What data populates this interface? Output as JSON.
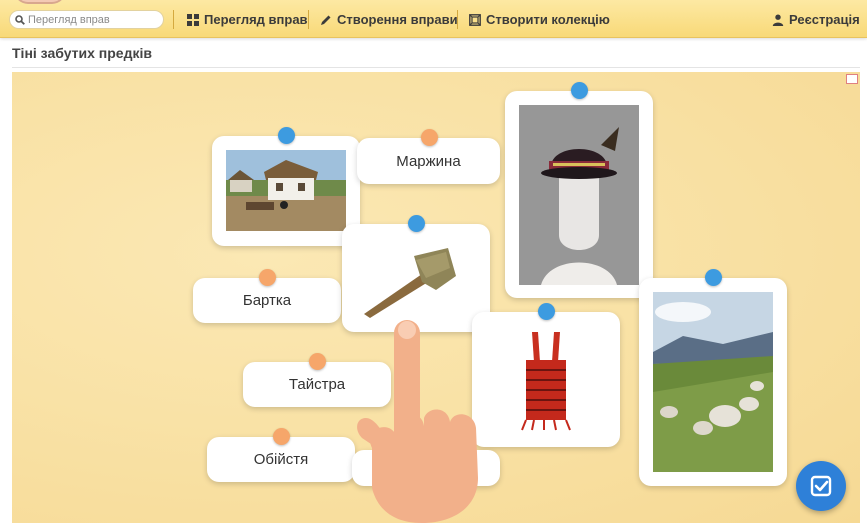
{
  "header": {
    "search_placeholder": "Перегляд вправ",
    "nav": {
      "browse": "Перегляд вправ",
      "create": "Створення вправи",
      "collection": "Створити колекцію",
      "register": "Реєстрація"
    }
  },
  "page": {
    "title": "Тіні забутих предків"
  },
  "words": {
    "marzhyna": "Маржина",
    "bartka": "Бартка",
    "taistra": "Тайстра",
    "obiistia": "Обійстя"
  },
  "icons": {
    "search": "search-icon",
    "grid": "grid-icon",
    "pencil": "pencil-icon",
    "collection": "collection-icon",
    "user": "user-icon",
    "expand": "expand-icon",
    "check": "check-icon"
  },
  "colors": {
    "header": "#f8d978",
    "board": "#f9e2a6",
    "pin_blue": "#3d9be0",
    "pin_orange": "#f6a66a",
    "check_button": "#2e80d8"
  }
}
